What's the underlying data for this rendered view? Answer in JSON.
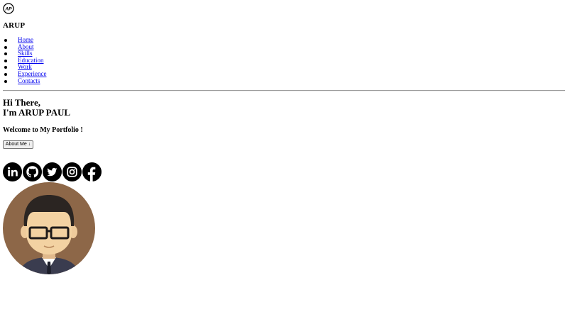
{
  "header": {
    "logo_icon": "ap-monogram-logo",
    "brand": "ARUP"
  },
  "nav": {
    "items": [
      {
        "label": "Home"
      },
      {
        "label": "About"
      },
      {
        "label": "Skills"
      },
      {
        "label": "Education"
      },
      {
        "label": "Work"
      },
      {
        "label": "Experience"
      },
      {
        "label": "Contacts"
      }
    ]
  },
  "hero": {
    "greeting": "Hi There,",
    "name_line": "I'm ARUP PAUL",
    "welcome": "Welcome to My Portfolio !",
    "about_button": "About Me ↓"
  },
  "socials": [
    {
      "icon": "linkedin-icon"
    },
    {
      "icon": "github-icon"
    },
    {
      "icon": "twitter-icon"
    },
    {
      "icon": "instagram-icon"
    },
    {
      "icon": "facebook-icon"
    }
  ],
  "avatar": {
    "icon": "cartoon-man-with-glasses-avatar",
    "bg_color": "#8d6748"
  }
}
